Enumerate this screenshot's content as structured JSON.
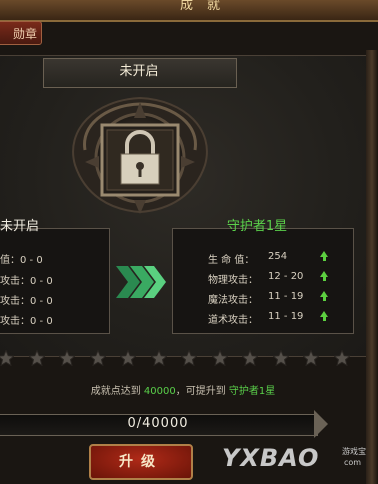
{
  "window": {
    "title": "成就"
  },
  "tabs": [
    {
      "label": "勋章"
    }
  ],
  "current": {
    "header": "未开启",
    "name": "未开启",
    "stats": [
      "值：0 - 0",
      "攻击：0 - 0",
      "攻击：0 - 0",
      "攻击：0 - 0"
    ]
  },
  "next": {
    "name": "守护者1星",
    "stats": [
      {
        "label": "生 命 值：",
        "value": "254"
      },
      {
        "label": "物理攻击：",
        "value": "12 - 20"
      },
      {
        "label": "魔法攻击：",
        "value": "11 - 19"
      },
      {
        "label": "道术攻击：",
        "value": "11 - 19"
      }
    ]
  },
  "stars": {
    "filled": 0,
    "total": 12
  },
  "condition": {
    "prefix": "成就点达到",
    "points": "40000",
    "middle": "，可提升到",
    "target": "守护者1星"
  },
  "progress": {
    "text": "0/40000",
    "current": 0,
    "max": 40000
  },
  "upgrade_button": {
    "label": "升级"
  },
  "watermark": {
    "brand": "YXBAO",
    "sub": "游戏宝",
    "url": "com"
  },
  "colors": {
    "green": "#5ad04a",
    "accent_red": "#9a2010"
  }
}
